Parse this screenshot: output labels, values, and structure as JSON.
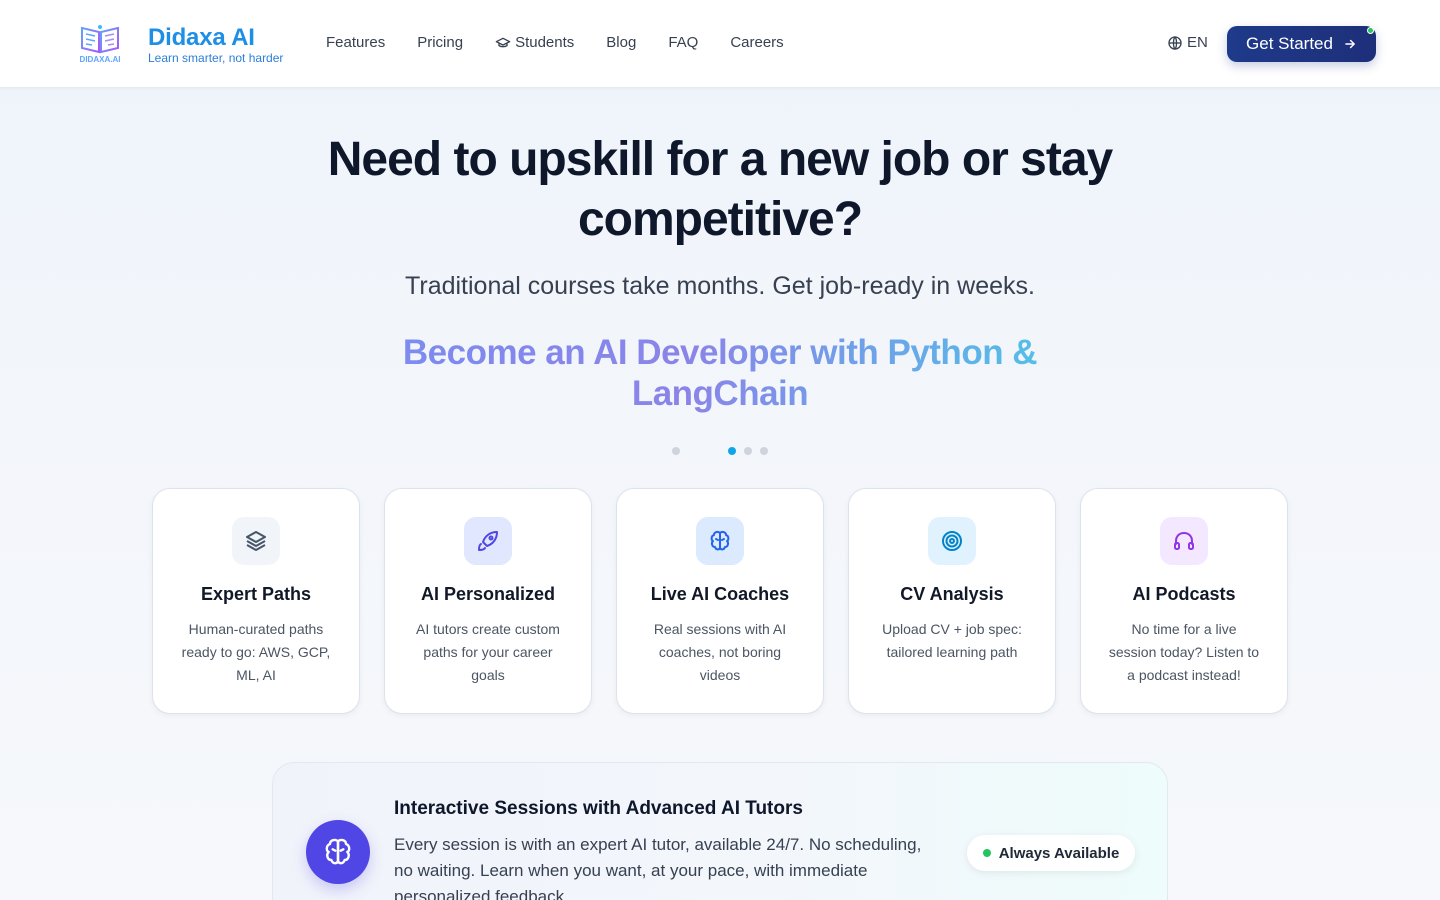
{
  "header": {
    "logo_text": "DIDAXA.AI",
    "brand_name": "Didaxa AI",
    "tagline": "Learn smarter, not harder",
    "nav": [
      {
        "label": "Features",
        "icon": ""
      },
      {
        "label": "Pricing",
        "icon": ""
      },
      {
        "label": "Students",
        "icon": "graduation-cap-icon"
      },
      {
        "label": "Blog",
        "icon": ""
      },
      {
        "label": "FAQ",
        "icon": ""
      },
      {
        "label": "Careers",
        "icon": ""
      }
    ],
    "language": "EN",
    "cta_label": "Get Started"
  },
  "hero": {
    "title": "Need to upskill for a new job or stay competitive?",
    "subtitle": "Traditional courses take months. Get job-ready in weeks.",
    "rotating_text": "Become an AI Developer with Python & LangChain",
    "carousel": {
      "count": 4,
      "active_index": 1
    }
  },
  "features": [
    {
      "icon": "layers-icon",
      "title": "Expert Paths",
      "desc": "Human-curated paths ready to go: AWS, GCP, ML, AI",
      "icon_bg": "#f1f5f9",
      "icon_color": "#475569"
    },
    {
      "icon": "rocket-icon",
      "title": "AI Personalized",
      "desc": "AI tutors create custom paths for your career goals",
      "icon_bg": "#e0e7ff",
      "icon_color": "#4f46e5"
    },
    {
      "icon": "brain-icon",
      "title": "Live AI Coaches",
      "desc": "Real sessions with AI coaches, not boring videos",
      "icon_bg": "#dbeafe",
      "icon_color": "#2563eb"
    },
    {
      "icon": "target-icon",
      "title": "CV Analysis",
      "desc": "Upload CV + job spec: tailored learning path",
      "icon_bg": "#e0f2fe",
      "icon_color": "#0284c7"
    },
    {
      "icon": "headphones-icon",
      "title": "AI Podcasts",
      "desc": "No time for a live session today? Listen to a podcast instead!",
      "icon_bg": "#f3e8ff",
      "icon_color": "#9333ea"
    }
  ],
  "banner": {
    "icon": "brain-icon",
    "title": "Interactive Sessions with Advanced AI Tutors",
    "desc": "Every session is with an expert AI tutor, available 24/7. No scheduling, no waiting. Learn when you want, at your pace, with immediate personalized feedback.",
    "badge": "Always Available"
  },
  "colors": {
    "accent": "#1e3a8a",
    "brand": "#1d8fe6",
    "status_green": "#22c55e",
    "banner_icon": "#4f46e5"
  }
}
